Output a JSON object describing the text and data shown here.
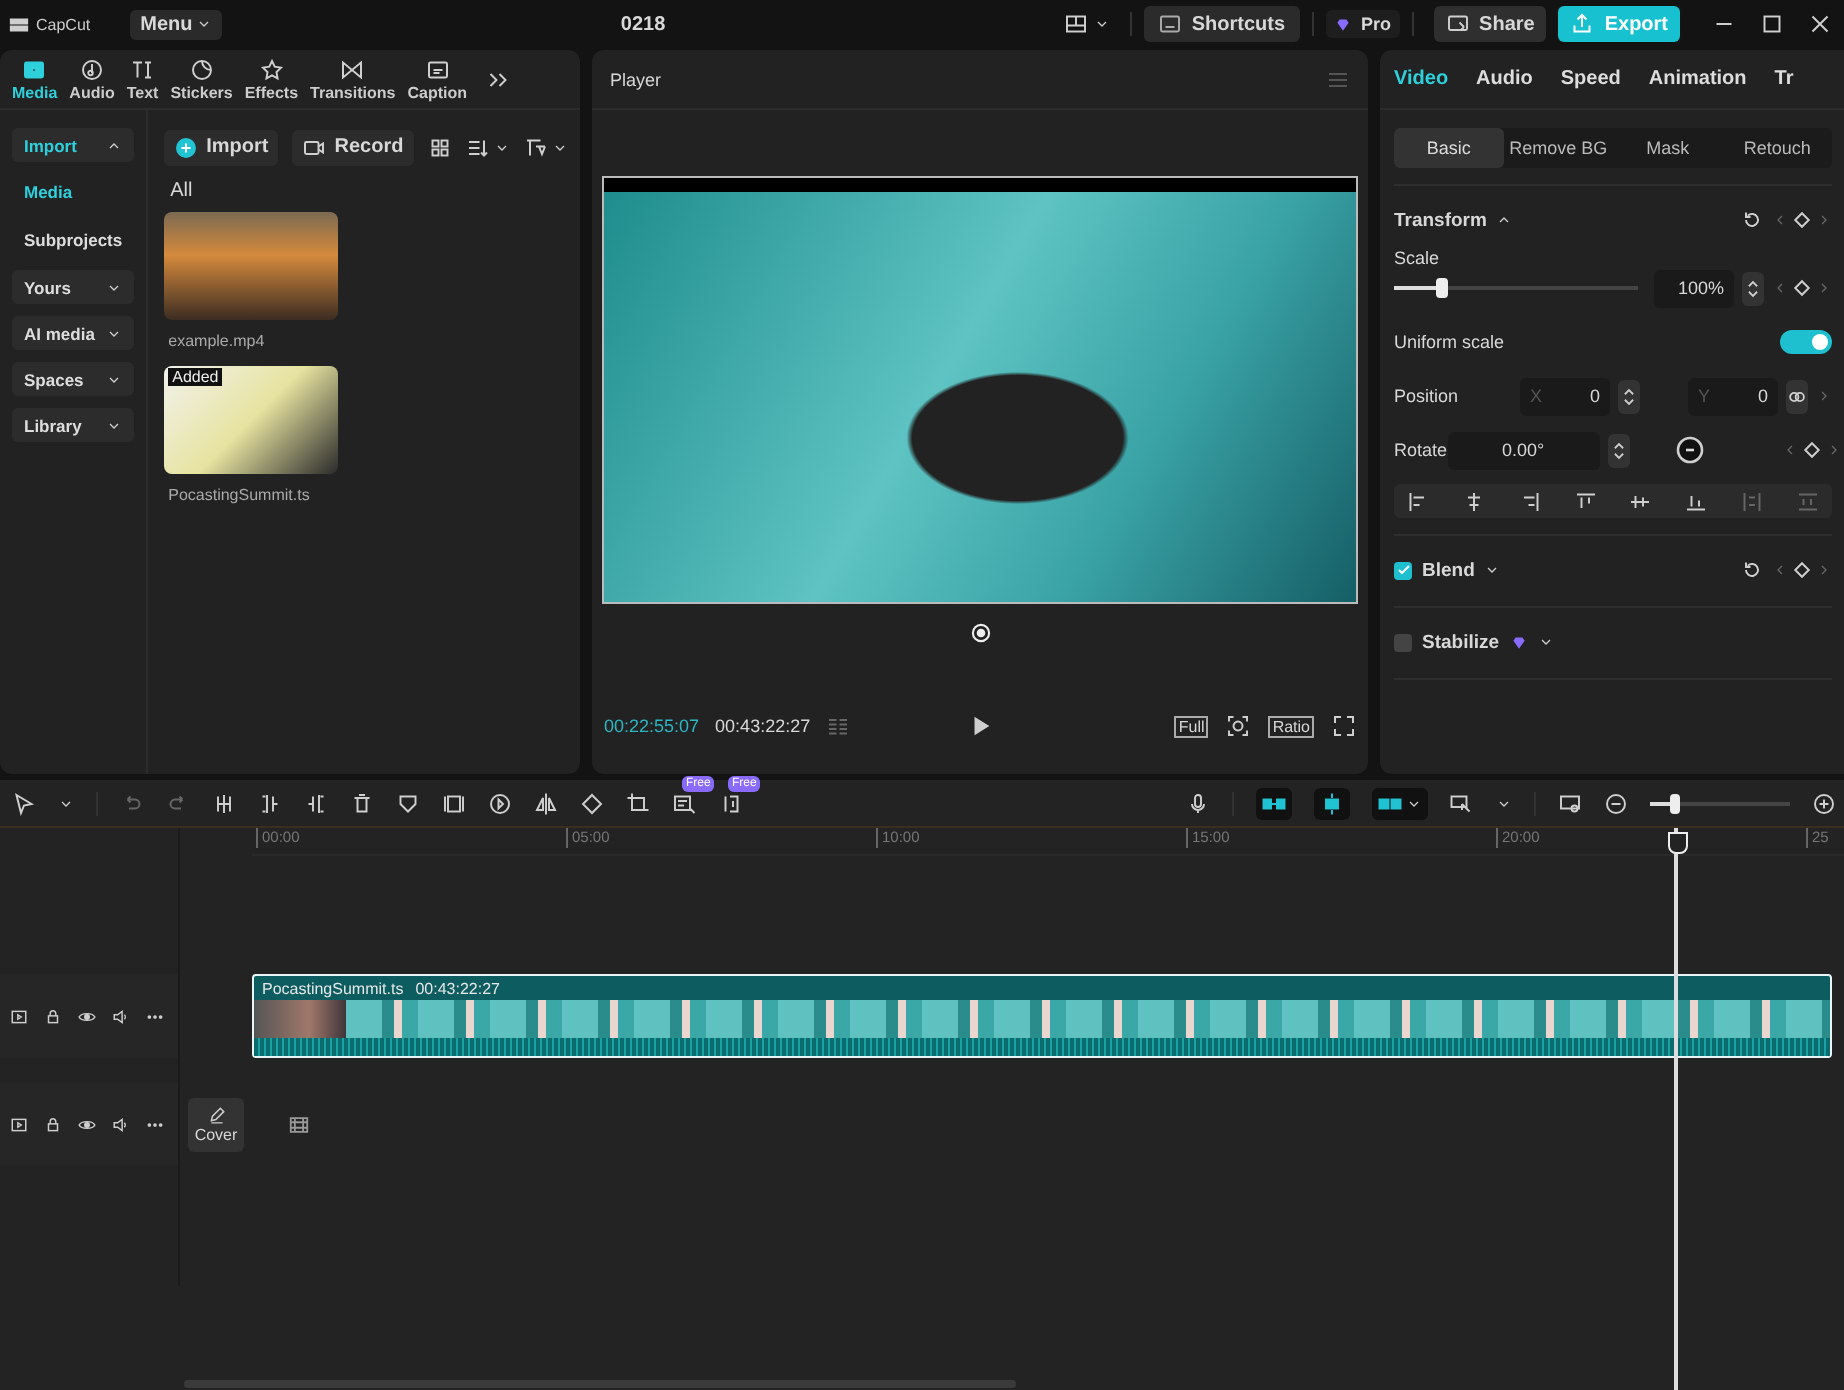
{
  "title_bar": {
    "logo": "CapCut",
    "menu": "Menu",
    "project": "0218",
    "shortcuts": "Shortcuts",
    "pro": "Pro",
    "share": "Share",
    "export": "Export"
  },
  "media_tabs": [
    {
      "label": "Media",
      "kind": "media",
      "selected": true
    },
    {
      "label": "Audio",
      "kind": "audio",
      "selected": false
    },
    {
      "label": "Text",
      "kind": "text",
      "selected": false
    },
    {
      "label": "Stickers",
      "kind": "stickers",
      "selected": false
    },
    {
      "label": "Effects",
      "kind": "effects",
      "selected": false
    },
    {
      "label": "Transitions",
      "kind": "transitions",
      "selected": false
    },
    {
      "label": "Caption",
      "kind": "caption",
      "selected": false
    }
  ],
  "media_sidebar": [
    {
      "label": "Import",
      "selected": true,
      "expanded": true,
      "children": [
        {
          "label": "Media",
          "selected": true
        },
        {
          "label": "Subprojects",
          "selected": false
        }
      ]
    },
    {
      "label": "Yours",
      "selected": false,
      "expanded": false
    },
    {
      "label": "AI media",
      "selected": false,
      "expanded": false
    },
    {
      "label": "Spaces",
      "selected": false,
      "expanded": false
    },
    {
      "label": "Library",
      "selected": false,
      "expanded": false
    }
  ],
  "media_toolbar": {
    "import": "Import",
    "record": "Record"
  },
  "media_filter": "All",
  "media_items": [
    {
      "name": "example.mp4"
    },
    {
      "name": "PocastingSummit.ts",
      "badge": "Added"
    }
  ],
  "player": {
    "title": "Player",
    "current_time": "00:22:55:07",
    "duration": "00:43:22:27",
    "full": "Full",
    "ratio": "Ratio"
  },
  "inspector": {
    "tabs": [
      {
        "label": "Video",
        "selected": true
      },
      {
        "label": "Audio",
        "selected": false
      },
      {
        "label": "Speed",
        "selected": false
      },
      {
        "label": "Animation",
        "selected": false
      },
      {
        "label": "Tr",
        "selected": false
      }
    ],
    "subtabs": [
      {
        "label": "Basic",
        "selected": true
      },
      {
        "label": "Remove BG",
        "selected": false
      },
      {
        "label": "Mask",
        "selected": false
      },
      {
        "label": "Retouch",
        "selected": false
      }
    ],
    "transform": {
      "title": "Transform",
      "scale_label": "Scale",
      "scale": {
        "level": 0.2
      },
      "scale_value": "100%",
      "uniform_label": "Uniform scale",
      "uniform_on": true,
      "position_label": "Position",
      "x_label": "X",
      "x_value": "0",
      "y_label": "Y",
      "y_value": "0",
      "rotate_label": "Rotate",
      "rotate_value": "0.00°"
    },
    "sections": [
      {
        "title": "Blend",
        "checked": true,
        "pro": false
      },
      {
        "title": "Stabilize",
        "checked": false,
        "pro": true
      }
    ]
  },
  "timeline": {
    "tool_badges": [
      "Free",
      "Free"
    ],
    "ruler": [
      "00:00",
      "05:00",
      "10:00",
      "15:00",
      "20:00",
      "25"
    ],
    "clip": {
      "name": "PocastingSummit.ts",
      "duration": "00:43:22:27"
    },
    "cover": "Cover",
    "zoom": {
      "level": 0.17
    }
  }
}
